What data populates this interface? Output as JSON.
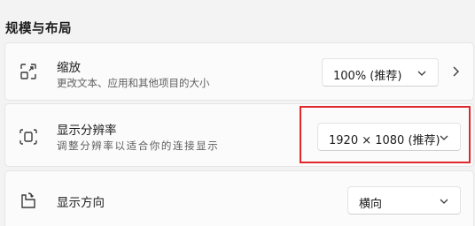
{
  "section": {
    "title": "规模与布局"
  },
  "scale": {
    "title": "缩放",
    "subtitle": "更改文本、应用和其他项目的大小",
    "value": "100% (推荐)",
    "icon": "scale-icon"
  },
  "resolution": {
    "title": "显示分辨率",
    "subtitle": "调整分辨率以适合你的连接显示",
    "value": "1920 × 1080 (推荐)",
    "icon": "resolution-icon"
  },
  "orientation": {
    "title": "显示方向",
    "value": "横向",
    "icon": "orientation-icon"
  },
  "colors": {
    "highlight": "#e0282c",
    "card": "#fbfbfb",
    "background": "#f3f3f3"
  }
}
